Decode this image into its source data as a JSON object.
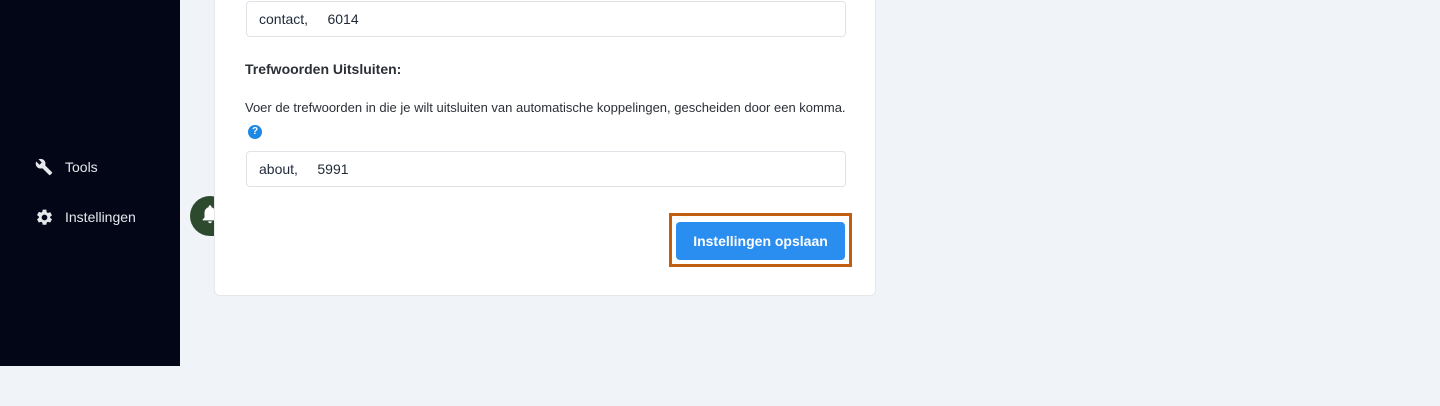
{
  "sidebar": {
    "items": [
      {
        "label": "Tools",
        "icon": "wrench-icon"
      },
      {
        "label": "Instellingen",
        "icon": "gear-icon"
      }
    ]
  },
  "notification": {
    "icon": "bell-icon"
  },
  "form": {
    "include_keywords_value": "contact,     6014",
    "exclude_title": "Trefwoorden Uitsluiten:",
    "exclude_description": "Voer de trefwoorden in die je wilt uitsluiten van automatische koppelingen, gescheiden door een komma.",
    "help_glyph": "?",
    "exclude_keywords_value": "about,     5991",
    "save_label": "Instellingen opslaan"
  },
  "colors": {
    "sidebar_bg": "#020617",
    "accent": "#2a8ef0",
    "focus_outline": "#c25e10",
    "bell_bg": "#2d4a2f"
  }
}
